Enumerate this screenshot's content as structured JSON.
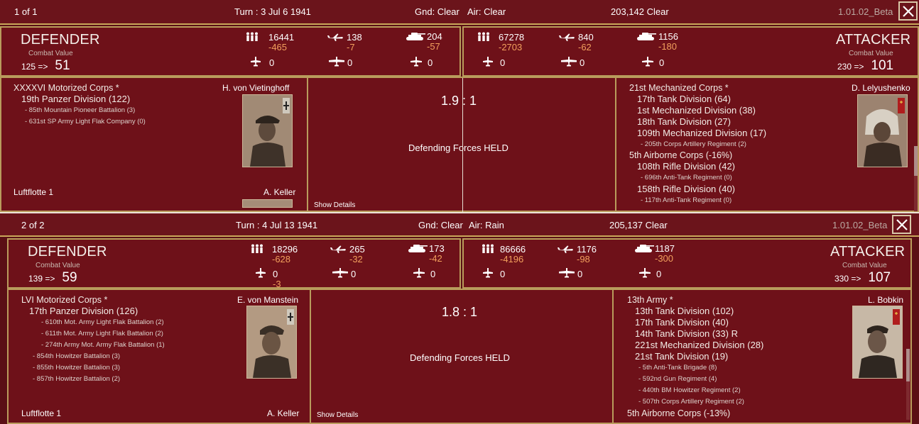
{
  "colors": {
    "background": "#5a0f15",
    "panel": "#6e1119",
    "border": "#b99c5c",
    "loss": "#f2a05d"
  },
  "reports": [
    {
      "page": "1 of 1",
      "turn": "Turn : 3   Jul 6 1941",
      "gnd": "Gnd: Clear",
      "air": "Air: Clear",
      "hex": "203,142   Clear",
      "version": "1.01.02_Beta",
      "defender": {
        "title": "DEFENDER",
        "cv_label": "Combat Value",
        "cv_start": "125   =>",
        "cv_end": "51",
        "men": "16441",
        "men_loss": "-465",
        "planes": "138",
        "planes_loss": "-7",
        "tanks": "204",
        "tanks_loss": "-57",
        "sub1": "0",
        "sub2": "0",
        "sub3": "0",
        "sub1_loss": "",
        "units": [
          {
            "lvl": 1,
            "text": "XXXXVI Motorized Corps *"
          },
          {
            "lvl": 2,
            "text": "19th Panzer Division (122)"
          },
          {
            "lvl": 3,
            "text": "- 85th Mountain Pioneer Battalion (3)"
          },
          {
            "lvl": 3,
            "text": "- 631st SP Army Light Flak Company (0)"
          }
        ],
        "commander": "H. von Vietinghoff",
        "air_hq": "Luftflotte 1",
        "air_commander": "A. Keller"
      },
      "ratio": "1.9 : 1",
      "result": "Defending Forces HELD",
      "show_details": "Show Details",
      "attacker": {
        "title": "ATTACKER",
        "cv_label": "Combat Value",
        "cv_start": "230   =>",
        "cv_end": "101",
        "men": "67278",
        "men_loss": "-2703",
        "planes": "840",
        "planes_loss": "-62",
        "tanks": "1156",
        "tanks_loss": "-180",
        "sub1": "0",
        "sub2": "0",
        "sub3": "0",
        "units": [
          {
            "lvl": 1,
            "text": "21st Mechanized Corps *"
          },
          {
            "lvl": 2,
            "text": "17th Tank Division (64)"
          },
          {
            "lvl": 2,
            "text": "1st Mechanized Division (38)"
          },
          {
            "lvl": 2,
            "text": "18th Tank Division (27)"
          },
          {
            "lvl": 2,
            "text": "109th Mechanized Division (17)"
          },
          {
            "lvl": 3,
            "text": "- 205th Corps Artillery Regiment (2)"
          },
          {
            "lvl": 1,
            "text": "5th Airborne Corps (-16%)"
          },
          {
            "lvl": 2,
            "text": "108th Rifle Division (42)"
          },
          {
            "lvl": 3,
            "text": "- 696th Anti-Tank Regiment (0)"
          },
          {
            "lvl": 2,
            "text": "158th Rifle Division (40)"
          },
          {
            "lvl": 3,
            "text": "- 117th Anti-Tank Regiment (0)"
          }
        ],
        "commander": "D. Lelyushenko"
      }
    },
    {
      "page": "2 of 2",
      "turn": "Turn : 4   Jul 13 1941",
      "gnd": "Gnd: Clear",
      "air": "Air: Rain",
      "hex": "205,137   Clear",
      "version": "1.01.02_Beta",
      "defender": {
        "title": "DEFENDER",
        "cv_label": "Combat Value",
        "cv_start": "139   =>",
        "cv_end": "59",
        "men": "18296",
        "men_loss": "-628",
        "planes": "265",
        "planes_loss": "-32",
        "tanks": "173",
        "tanks_loss": "-42",
        "sub1": "0",
        "sub2": "0",
        "sub3": "0",
        "sub1_loss": "-3",
        "units": [
          {
            "lvl": 1,
            "text": "LVI Motorized Corps *"
          },
          {
            "lvl": 2,
            "text": "17th Panzer Division (126)"
          },
          {
            "lvl": 4,
            "text": "- 610th Mot. Army Light Flak Battalion (2)"
          },
          {
            "lvl": 4,
            "text": "- 611th Mot. Army Light Flak Battalion (2)"
          },
          {
            "lvl": 4,
            "text": "- 274th Army Mot. Army Flak Battalion (1)"
          },
          {
            "lvl": 3,
            "text": "- 854th Howitzer Battalion (3)"
          },
          {
            "lvl": 3,
            "text": "- 855th Howitzer Battalion (3)"
          },
          {
            "lvl": 3,
            "text": "- 857th Howitzer Battalion (2)"
          }
        ],
        "commander": "E. von Manstein",
        "air_hq": "Luftflotte 1",
        "air_commander": "A. Keller"
      },
      "ratio": "1.8 : 1",
      "result": "Defending Forces HELD",
      "show_details": "Show Details",
      "attacker": {
        "title": "ATTACKER",
        "cv_label": "Combat Value",
        "cv_start": "330   =>",
        "cv_end": "107",
        "men": "86666",
        "men_loss": "-4196",
        "planes": "1176",
        "planes_loss": "-98",
        "tanks": "1187",
        "tanks_loss": "-300",
        "sub1": "0",
        "sub2": "0",
        "sub3": "0",
        "units": [
          {
            "lvl": 1,
            "text": "13th Army *"
          },
          {
            "lvl": 2,
            "text": "13th Tank Division (102)"
          },
          {
            "lvl": 2,
            "text": "17th Tank Division (40)"
          },
          {
            "lvl": 2,
            "text": "14th Tank Division (33)  R"
          },
          {
            "lvl": 2,
            "text": "221st Mechanized Division (28)"
          },
          {
            "lvl": 2,
            "text": "21st Tank Division (19)"
          },
          {
            "lvl": 3,
            "text": "- 5th Anti-Tank Brigade (8)"
          },
          {
            "lvl": 3,
            "text": "- 592nd Gun Regiment (4)"
          },
          {
            "lvl": 3,
            "text": "- 440th BM Howitzer Regiment (2)"
          },
          {
            "lvl": 3,
            "text": "- 507th Corps Artillery Regiment (2)"
          },
          {
            "lvl": 1,
            "text": "5th Airborne Corps (-13%)"
          }
        ],
        "commander": "L. Bobkin"
      }
    }
  ]
}
